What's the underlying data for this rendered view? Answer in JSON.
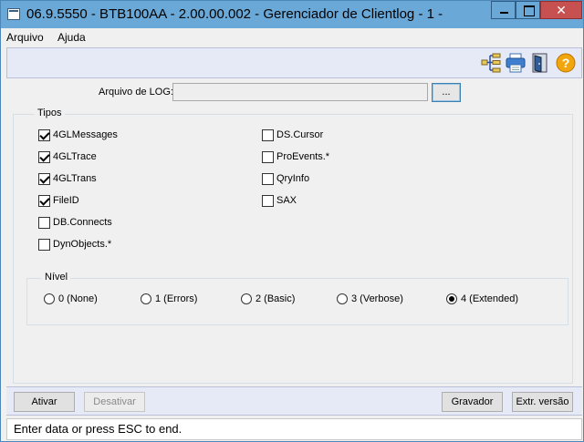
{
  "window": {
    "title": "06.9.5550 - BTB100AA - 2.00.00.002 - Gerenciador de Clientlog - 1 -",
    "close_glyph": "✕"
  },
  "menu": {
    "items": [
      "Arquivo",
      "Ajuda"
    ]
  },
  "toolbar": {
    "icons": [
      "tree-structure-icon",
      "printer-icon",
      "exit-door-icon",
      "help-icon"
    ]
  },
  "file": {
    "label": "Arquivo de LOG:",
    "value": "",
    "browse_label": "..."
  },
  "tipos": {
    "legend": "Tipos",
    "left": [
      {
        "label": "4GLMessages",
        "checked": true
      },
      {
        "label": "4GLTrace",
        "checked": true
      },
      {
        "label": "4GLTrans",
        "checked": true
      },
      {
        "label": "FileID",
        "checked": true
      },
      {
        "label": "DB.Connects",
        "checked": false
      },
      {
        "label": "DynObjects.*",
        "checked": false
      }
    ],
    "right": [
      {
        "label": "DS.Cursor",
        "checked": false
      },
      {
        "label": "ProEvents.*",
        "checked": false
      },
      {
        "label": "QryInfo",
        "checked": false
      },
      {
        "label": "SAX",
        "checked": false
      }
    ]
  },
  "nivel": {
    "legend": "Nível",
    "options": [
      {
        "label": "0 (None)",
        "selected": false
      },
      {
        "label": "1 (Errors)",
        "selected": false
      },
      {
        "label": "2 (Basic)",
        "selected": false
      },
      {
        "label": "3 (Verbose)",
        "selected": false
      },
      {
        "label": "4 (Extended)",
        "selected": true
      }
    ]
  },
  "buttons": {
    "ativar": "Ativar",
    "desativar": "Desativar",
    "gravador": "Gravador",
    "extr_versao": "Extr. versão"
  },
  "status": "Enter data or press ESC to end.",
  "colors": {
    "titlebar": "#6aa8d8",
    "close": "#c75050",
    "toolbar": "#e6e9f6"
  }
}
